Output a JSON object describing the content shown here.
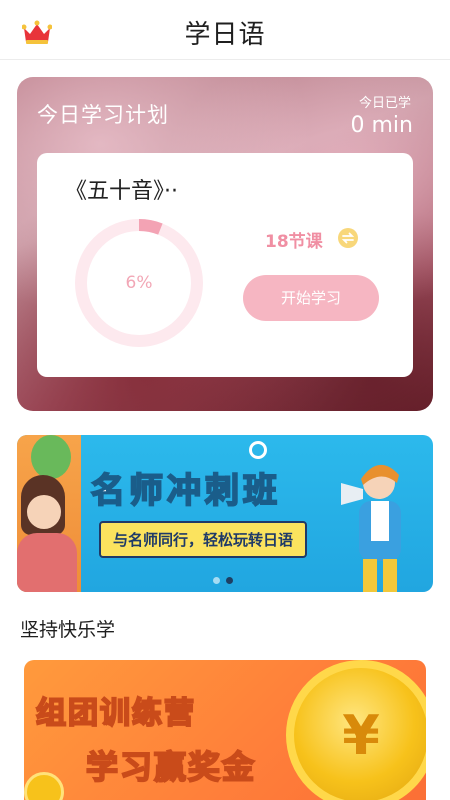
{
  "header": {
    "title": "学日语",
    "crown_icon": "crown-icon"
  },
  "plan": {
    "title": "今日学习计划",
    "today_label": "今日已学",
    "today_value": "0 min",
    "course_name": "《五十音》··",
    "progress_percent": 6,
    "progress_text": "6%",
    "lessons_text": "18节课",
    "switch_icon": "switch-icon",
    "start_button": "开始学习"
  },
  "banner": {
    "title": "名师冲刺班",
    "subtitle": "与名师同行，轻松玩转日语",
    "slides": 2,
    "active_slide": 2
  },
  "section": {
    "title": "坚持快乐学"
  },
  "promo": {
    "line1": "组团训练营",
    "line2": "学习赢奖金",
    "coin_symbol": "¥"
  },
  "colors": {
    "accent_pink": "#f08fa3",
    "button_pink": "#f6b6c2",
    "banner_blue": "#2cb9ec",
    "promo_orange": "#ff8a3a"
  }
}
